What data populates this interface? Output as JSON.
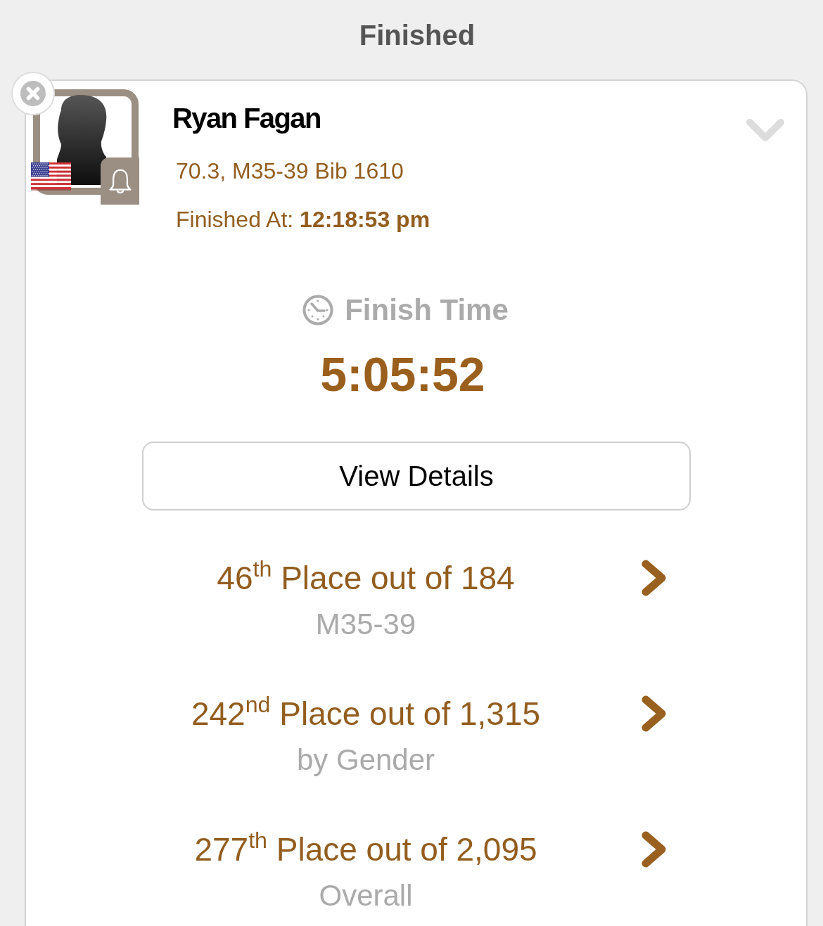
{
  "header": {
    "title": "Finished"
  },
  "athlete": {
    "name": "Ryan Fagan",
    "details": "70.3, M35-39 Bib 1610",
    "finished_at": "Finished At: **12:18:53 pm**"
  },
  "finish": {
    "label": "Finish Time",
    "time": "5:05:52"
  },
  "view_details_button": {
    "label": "View Details"
  },
  "placements": [
    {
      "place": "46$^{th}$ Place out of 184",
      "category": "M35-39"
    },
    {
      "place": "242$^{nd}$ Place out of 1,315",
      "category": "by Gender"
    },
    {
      "place": "277$^{th}$ Place out of 2,095",
      "category": "Overall"
    }
  ]
}
